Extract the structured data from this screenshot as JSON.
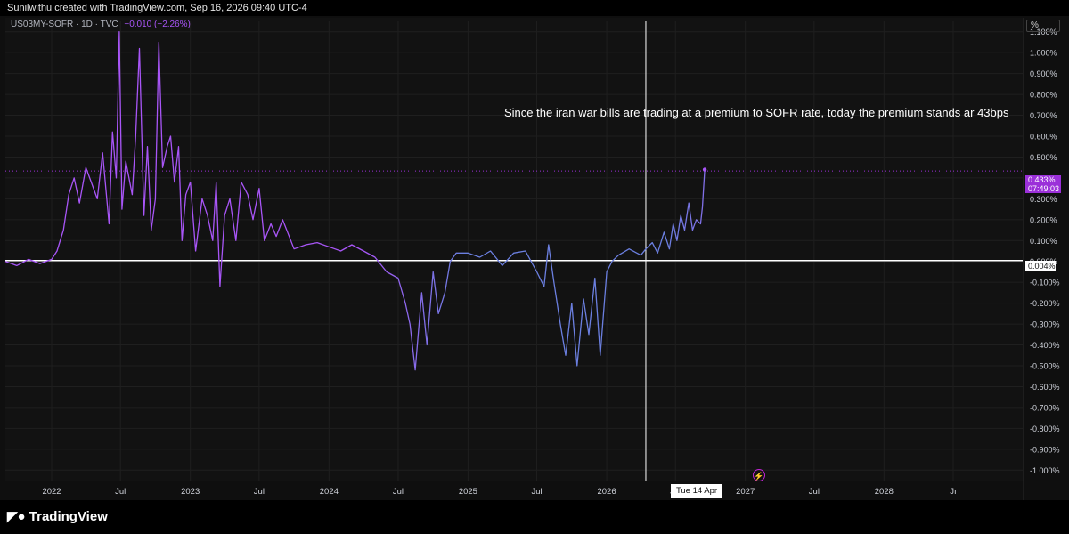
{
  "header": {
    "attribution": "Sunilwithu created with TradingView.com, Sep 16, 2026 09:40 UTC-4"
  },
  "legend": {
    "symbol": "US03MY-SOFR · 1D · TVC",
    "change": "−0.010 (−2.26%)"
  },
  "annotation": "Since the iran war bills are trading at a premium to SOFR rate, today the premium stands ar 43bps",
  "unit_label": "%",
  "last_price": {
    "value": "0.433%",
    "countdown": "07:49:03"
  },
  "zero_line_label": "0.004%",
  "crosshair_label": "Tue 14 Apr '26",
  "footer": {
    "brand": "TradingView"
  },
  "colors": {
    "line_early": "#a855f7",
    "line_late": "#6b7fe0",
    "crosshair": "#ffffff",
    "background": "#121212"
  },
  "icons": {
    "brand_logo": "tradingview-logo-icon",
    "alert": "lightning-bolt-icon"
  },
  "chart_data": {
    "type": "line",
    "title": "",
    "xlabel": "",
    "ylabel": "",
    "ylim": [
      -1.05,
      1.15
    ],
    "xlim": [
      "2021-09-01",
      "2028-12-31"
    ],
    "y_ticks": [
      "1.100%",
      "1.000%",
      "0.900%",
      "0.800%",
      "0.700%",
      "0.600%",
      "0.500%",
      "0.400%",
      "0.300%",
      "0.200%",
      "0.100%",
      "0.000%",
      "-0.100%",
      "-0.200%",
      "-0.300%",
      "-0.400%",
      "-0.500%",
      "-0.600%",
      "-0.700%",
      "-0.800%",
      "-0.900%",
      "-1.000%"
    ],
    "x_ticks": [
      {
        "label": "2022",
        "date": "2022-01-01"
      },
      {
        "label": "Jul",
        "date": "2022-07-01"
      },
      {
        "label": "2023",
        "date": "2023-01-01"
      },
      {
        "label": "Jul",
        "date": "2023-07-01"
      },
      {
        "label": "2024",
        "date": "2024-01-01"
      },
      {
        "label": "Jul",
        "date": "2024-07-01"
      },
      {
        "label": "2025",
        "date": "2025-01-01"
      },
      {
        "label": "Jul",
        "date": "2025-07-01"
      },
      {
        "label": "2026",
        "date": "2026-01-01"
      },
      {
        "label": "Jul",
        "date": "2026-07-01"
      },
      {
        "label": "2027",
        "date": "2027-01-01"
      },
      {
        "label": "Jul",
        "date": "2027-07-01"
      },
      {
        "label": "2028",
        "date": "2028-01-01"
      },
      {
        "label": "Jı",
        "date": "2028-07-01"
      }
    ],
    "horizontal_line": 0.004,
    "crosshair_date": "2026-04-14",
    "last_value": 0.433,
    "grid": true,
    "series": [
      {
        "x": [
          "2021-09-01",
          "2021-10-01",
          "2021-11-01",
          "2021-12-01",
          "2022-01-01",
          "2022-01-15",
          "2022-02-01",
          "2022-02-15",
          "2022-03-01",
          "2022-03-15",
          "2022-04-01",
          "2022-04-15",
          "2022-05-01",
          "2022-05-15",
          "2022-06-01",
          "2022-06-10",
          "2022-06-20",
          "2022-06-28",
          "2022-07-05",
          "2022-07-15",
          "2022-08-01",
          "2022-08-10",
          "2022-08-20",
          "2022-09-01",
          "2022-09-10",
          "2022-09-20",
          "2022-10-01",
          "2022-10-10",
          "2022-10-20",
          "2022-11-01",
          "2022-11-10",
          "2022-11-20",
          "2022-12-01",
          "2022-12-10",
          "2022-12-20",
          "2023-01-01",
          "2023-01-15",
          "2023-02-01",
          "2023-02-15",
          "2023-03-01",
          "2023-03-10",
          "2023-03-20",
          "2023-04-01",
          "2023-04-15",
          "2023-05-01",
          "2023-05-15",
          "2023-06-01",
          "2023-06-15",
          "2023-07-01",
          "2023-07-15",
          "2023-08-01",
          "2023-08-15",
          "2023-09-01",
          "2023-10-01",
          "2023-11-01",
          "2023-12-01",
          "2024-01-01",
          "2024-02-01",
          "2024-03-01",
          "2024-04-01",
          "2024-05-01",
          "2024-06-01",
          "2024-07-01",
          "2024-07-20",
          "2024-08-01",
          "2024-08-15",
          "2024-09-01",
          "2024-09-15",
          "2024-10-01",
          "2024-10-15",
          "2024-11-01",
          "2024-11-15",
          "2024-12-01",
          "2025-01-01",
          "2025-02-01",
          "2025-03-01",
          "2025-04-01",
          "2025-05-01",
          "2025-06-01",
          "2025-07-01",
          "2025-07-20",
          "2025-08-01",
          "2025-08-15",
          "2025-09-01",
          "2025-09-15",
          "2025-10-01",
          "2025-10-15",
          "2025-11-01",
          "2025-11-15",
          "2025-12-01",
          "2025-12-15",
          "2026-01-01",
          "2026-01-15",
          "2026-02-01",
          "2026-03-01",
          "2026-04-01",
          "2026-04-14",
          "2026-05-01",
          "2026-05-15",
          "2026-06-01",
          "2026-06-15",
          "2026-06-25",
          "2026-07-05",
          "2026-07-15",
          "2026-07-25",
          "2026-08-05",
          "2026-08-15",
          "2026-08-25",
          "2026-09-05",
          "2026-09-10",
          "2026-09-16"
        ],
        "values": [
          0.0,
          -0.02,
          0.01,
          -0.01,
          0.01,
          0.05,
          0.15,
          0.32,
          0.4,
          0.28,
          0.45,
          0.38,
          0.3,
          0.52,
          0.18,
          0.62,
          0.4,
          1.1,
          0.25,
          0.48,
          0.32,
          0.6,
          1.02,
          0.22,
          0.55,
          0.15,
          0.3,
          1.05,
          0.45,
          0.55,
          0.6,
          0.38,
          0.55,
          0.1,
          0.32,
          0.38,
          0.05,
          0.3,
          0.22,
          0.1,
          0.38,
          -0.12,
          0.22,
          0.3,
          0.1,
          0.38,
          0.32,
          0.2,
          0.35,
          0.1,
          0.18,
          0.12,
          0.2,
          0.06,
          0.08,
          0.09,
          0.07,
          0.05,
          0.08,
          0.05,
          0.02,
          -0.05,
          -0.08,
          -0.2,
          -0.3,
          -0.52,
          -0.15,
          -0.4,
          -0.05,
          -0.25,
          -0.15,
          0.0,
          0.04,
          0.04,
          0.02,
          0.05,
          -0.02,
          0.04,
          0.05,
          -0.05,
          -0.12,
          0.08,
          -0.1,
          -0.3,
          -0.45,
          -0.2,
          -0.5,
          -0.18,
          -0.35,
          -0.08,
          -0.45,
          -0.05,
          0.0,
          0.03,
          0.06,
          0.03,
          0.06,
          0.09,
          0.04,
          0.14,
          0.06,
          0.18,
          0.1,
          0.22,
          0.15,
          0.28,
          0.15,
          0.2,
          0.18,
          0.26,
          0.44
        ]
      }
    ]
  }
}
